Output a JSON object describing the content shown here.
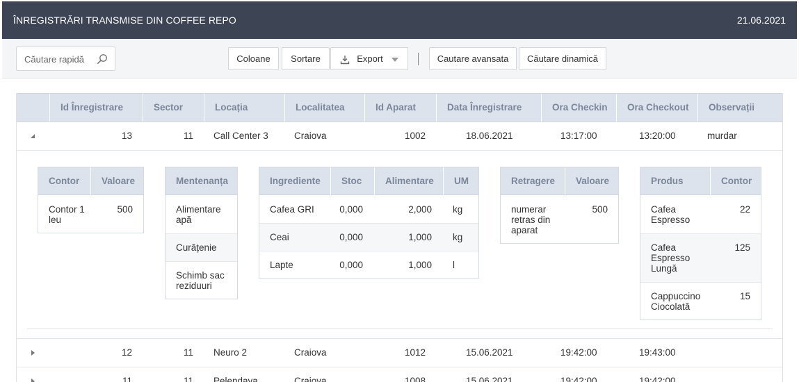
{
  "header": {
    "title": "ÎNREGISTRĂRI TRANSMISE DIN COFFEE REPO",
    "date": "21.06.2021"
  },
  "toolbar": {
    "search_placeholder": "Căutare rapidă",
    "buttons": {
      "columns": "Coloane",
      "sort": "Sortare",
      "export": "Export",
      "advanced": "Cautare avansata",
      "dynamic": "Căutare dinamică"
    }
  },
  "grid": {
    "columns": [
      "Id Înregistrare",
      "Sector",
      "Locația",
      "Localitatea",
      "Id Aparat",
      "Data Înregistrare",
      "Ora Checkin",
      "Ora Checkout",
      "Observații"
    ],
    "rows": [
      {
        "id": "13",
        "sector": "11",
        "locatie": "Call Center 3",
        "localitate": "Craiova",
        "aparat": "1002",
        "data": "18.06.2021",
        "checkin": "13:17:00",
        "checkout": "13:20:00",
        "obs": "murdar",
        "expanded": true
      },
      {
        "id": "12",
        "sector": "11",
        "locatie": "Neuro 2",
        "localitate": "Craiova",
        "aparat": "1012",
        "data": "15.06.2021",
        "checkin": "19:42:00",
        "checkout": "19:43:00",
        "obs": ""
      },
      {
        "id": "11",
        "sector": "11",
        "locatie": "Pelendava",
        "localitate": "Craiova",
        "aparat": "1008",
        "data": "15.06.2021",
        "checkin": "19:42:00",
        "checkout": "19:42:00",
        "obs": ""
      }
    ]
  },
  "detail": {
    "contor": {
      "headers": [
        "Contor",
        "Valoare"
      ],
      "rows": [
        {
          "name": "Contor 1 leu",
          "value": "500"
        }
      ]
    },
    "mentenanta": {
      "headers": [
        "Mentenanța"
      ],
      "rows": [
        "Alimentare apă",
        "Curățenie",
        "Schimb sac reziduuri"
      ]
    },
    "ingrediente": {
      "headers": [
        "Ingrediente",
        "Stoc",
        "Alimentare",
        "UM"
      ],
      "rows": [
        {
          "name": "Cafea GRI",
          "stoc": "0,000",
          "alim": "2,000",
          "um": "kg"
        },
        {
          "name": "Ceai",
          "stoc": "0,000",
          "alim": "1,000",
          "um": "kg"
        },
        {
          "name": "Lapte",
          "stoc": "0,000",
          "alim": "1,000",
          "um": "l"
        }
      ]
    },
    "retragere": {
      "headers": [
        "Retragere",
        "Valoare"
      ],
      "rows": [
        {
          "name": "numerar retras din aparat",
          "value": "500"
        }
      ]
    },
    "produs": {
      "headers": [
        "Produs",
        "Contor"
      ],
      "rows": [
        {
          "name": "Cafea Espresso",
          "value": "22"
        },
        {
          "name": "Cafea Espresso Lungă",
          "value": "125"
        },
        {
          "name": "Cappuccino Ciocolată",
          "value": "15"
        }
      ]
    }
  }
}
